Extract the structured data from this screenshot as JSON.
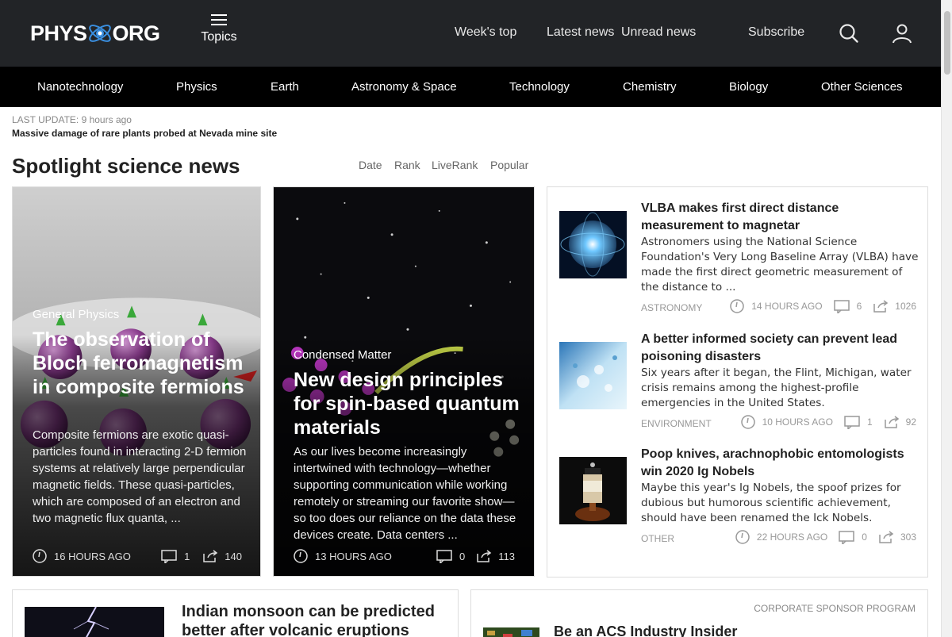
{
  "header": {
    "logo_left": "PHYS",
    "logo_right": "ORG",
    "topics_label": "Topics",
    "nav": [
      "Week's top",
      "Latest news",
      "Unread news",
      "Subscribe"
    ],
    "search_icon": "search-icon",
    "user_icon": "user-icon"
  },
  "categories": [
    "Nanotechnology",
    "Physics",
    "Earth",
    "Astronomy & Space",
    "Technology",
    "Chemistry",
    "Biology",
    "Other Sciences"
  ],
  "last_update": {
    "label": "LAST UPDATE: 9 hours ago",
    "headline": "Massive damage of rare plants probed at Nevada mine site"
  },
  "section": {
    "title": "Spotlight science news",
    "sort_tabs": [
      "Date",
      "Rank",
      "LiveRank",
      "Popular"
    ]
  },
  "hero": [
    {
      "category": "General Physics",
      "title": "The observation of Bloch ferromagnetism in composite fermions",
      "desc": "Composite fermions are exotic quasi-particles found in interacting 2-D fermion systems at relatively large perpendicular magnetic fields. These quasi-particles, which are composed of an electron and two magnetic flux quanta, ...",
      "time": "16 HOURS AGO",
      "comments": "1",
      "shares": "140"
    },
    {
      "category": "Condensed Matter",
      "title": "New design principles for spin-based quantum materials",
      "desc": "As our lives become increasingly intertwined with technology—whether supporting communication while working remotely or streaming our favorite show—so too does our reliance on the data these devices create. Data centers ...",
      "time": "13 HOURS AGO",
      "comments": "0",
      "shares": "113"
    }
  ],
  "side": [
    {
      "title": "VLBA makes first direct distance measurement to magnetar",
      "desc": "Astronomers using the National Science Foundation's Very Long Baseline Array (VLBA) have made the first direct geometric measurement of the distance to ...",
      "category": "ASTRONOMY",
      "time": "14 HOURS AGO",
      "comments": "6",
      "shares": "1026"
    },
    {
      "title": "A better informed society can prevent lead poisoning disasters",
      "desc": "Six years after it began, the Flint, Michigan, water crisis remains among the highest-profile emergencies in the United States.",
      "category": "ENVIRONMENT",
      "time": "10 HOURS AGO",
      "comments": "1",
      "shares": "92"
    },
    {
      "title": "Poop knives, arachnophobic entomologists win 2020 Ig Nobels",
      "desc": "Maybe this year's Ig Nobels, the spoof prizes for dubious but humorous scientific achievement, should have been renamed the Ick Nobels.",
      "category": "OTHER",
      "time": "22 HOURS AGO",
      "comments": "0",
      "shares": "303"
    }
  ],
  "bottom": {
    "left_title": "Indian monsoon can be predicted better after volcanic eruptions",
    "sponsor_label": "CORPORATE SPONSOR PROGRAM",
    "right_title": "Be an ACS Industry Insider"
  },
  "colors": {
    "header_bg": "#222427",
    "category_bg": "#000000",
    "logo_accent": "#3a8fe0"
  }
}
